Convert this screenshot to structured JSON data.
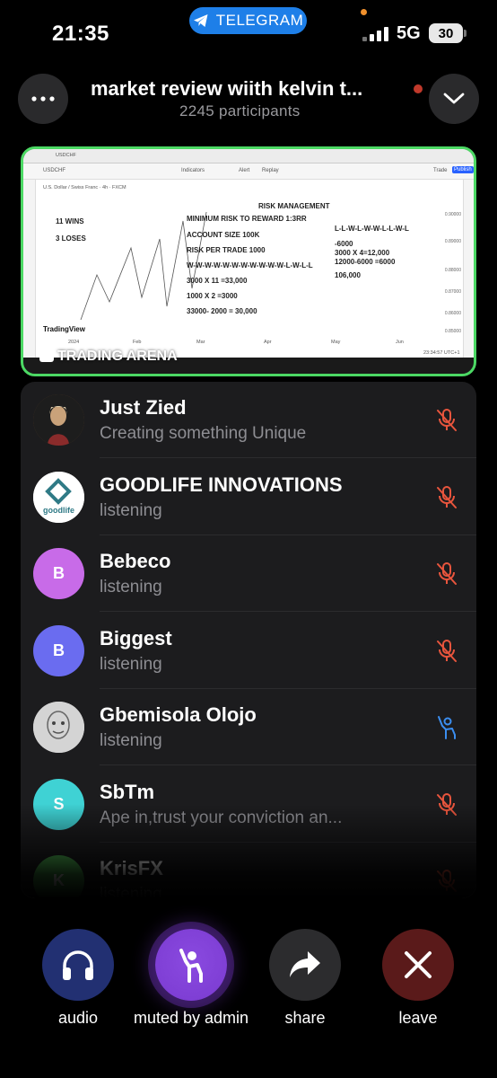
{
  "status_bar": {
    "time": "21:35",
    "app_pill": "TELEGRAM",
    "network": "5G",
    "battery": "30"
  },
  "header": {
    "title": "market review wiith kelvin t...",
    "participants": "2245 participants",
    "more_icon": "more-icon",
    "collapse_icon": "chevron-down-icon"
  },
  "video": {
    "label": "TRADING ARENA",
    "screen": {
      "pair": "USDCHF",
      "instrument": "U.S. Dollar / Swiss Franc · 4h · FXCM",
      "indicators": "Indicators",
      "alert": "Alert",
      "replay": "Replay",
      "publish": "Publish",
      "trade": "Trade",
      "title": "RISK MANAGEMENT",
      "wins": "11 WINS",
      "loses": "3 LOSES",
      "min_risk": "MINIMUM RISK TO REWARD 1:3RR",
      "account": "ACCOUNT SIZE 100K",
      "risk_per_trade": "RISK PER TRADE 1000",
      "sequence1": "W-W-W-W-W-W-W-W-W-W-W-L-W-L-L",
      "calc1": "3000 X 11 =33,000",
      "calc2": "1000 X 2 =3000",
      "calc3": "33000- 2000 = 30,000",
      "sequence2": "L-L-W-L-W-W-L-L-W-L",
      "calc4": "-6000",
      "calc5": "3000 X 4=12,000",
      "calc6": "12000-6000 =6000",
      "calc7": "106,000",
      "logo": "TradingView",
      "x_labels": [
        "2024",
        "Feb",
        "Mar",
        "Apr",
        "May",
        "Jun"
      ],
      "clock": "23:34:57 UTC+1"
    }
  },
  "participants": [
    {
      "name": "Just Zied",
      "status": "Creating something Unique",
      "avatar_letter": "",
      "avatar_color": "#6b4a2a",
      "mic": "muted",
      "mic_color": "#e8553d"
    },
    {
      "name": "GOODLIFE INNOVATIONS",
      "status": "listening",
      "avatar_letter": "",
      "avatar_color": "#ffffff",
      "mic": "muted",
      "mic_color": "#e8553d"
    },
    {
      "name": "Bebeco",
      "status": "listening",
      "avatar_letter": "B",
      "avatar_color": "#c86be8",
      "mic": "muted",
      "mic_color": "#e8553d"
    },
    {
      "name": "Biggest",
      "status": "listening",
      "avatar_letter": "B",
      "avatar_color": "#6a6cf0",
      "mic": "muted",
      "mic_color": "#e8553d"
    },
    {
      "name": "Gbemisola Olojo",
      "status": "listening",
      "avatar_letter": "",
      "avatar_color": "#cfcfcf",
      "mic": "raised-hand",
      "mic_color": "#3b8ef0"
    },
    {
      "name": "SbTm",
      "status": "Ape in,trust your conviction an...",
      "avatar_letter": "S",
      "avatar_color": "#3fd2d4",
      "mic": "muted",
      "mic_color": "#e8553d"
    },
    {
      "name": "KrisFX",
      "status": "listening",
      "avatar_letter": "K",
      "avatar_color": "#4caf50",
      "mic": "muted",
      "mic_color": "#e8553d"
    }
  ],
  "controls": {
    "audio": {
      "label": "audio",
      "icon": "headphones-icon",
      "color": "#223072"
    },
    "muted": {
      "label": "muted by admin",
      "icon": "raised-hand-icon",
      "color": "#7a3ad0"
    },
    "share": {
      "label": "share",
      "icon": "share-arrow-icon",
      "color": "#2c2c2e"
    },
    "leave": {
      "label": "leave",
      "icon": "close-icon",
      "color": "#5a1a1a"
    }
  },
  "colors": {
    "speaking_border": "#4cd964",
    "muted_mic": "#e8553d",
    "telegram_blue": "#1e7fe8"
  }
}
